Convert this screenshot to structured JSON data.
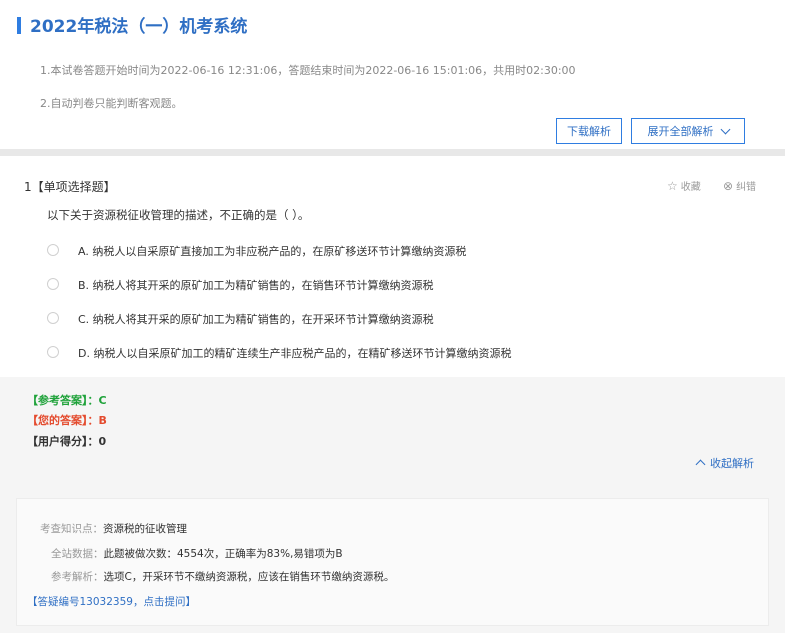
{
  "header": {
    "title": "2022年税法（一）机考系统",
    "info_line1": "1.本试卷答题开始时间为2022-06-16 12:31:06，答题结束时间为2022-06-16 15:01:06，共用时02:30:00",
    "info_line2": "2.自动判卷只能判断客观题。",
    "download_label": "下载解析",
    "expand_all_label": "展开全部解析"
  },
  "question": {
    "number_type": "1【单项选择题】",
    "favorite_label": "收藏",
    "report_error_label": "纠错",
    "stem": "以下关于资源税征收管理的描述，不正确的是（  ）。",
    "options": [
      "A. 纳税人以自采原矿直接加工为非应税产品的，在原矿移送环节计算缴纳资源税",
      "B. 纳税人将其开采的原矿加工为精矿销售的，在销售环节计算缴纳资源税",
      "C. 纳税人将其开采的原矿加工为精矿销售的，在开采环节计算缴纳资源税",
      "D. 纳税人以自采原矿加工的精矿连续生产非应税产品的，在精矿移送环节计算缴纳资源税"
    ]
  },
  "answers": {
    "reference": "【参考答案】：C",
    "yours": "【您的答案】：B",
    "score": "【用户得分】：0",
    "collapse_label": "收起解析"
  },
  "analysis": {
    "knowledge_label": "考查知识点：",
    "knowledge_value": "资源税的征收管理",
    "stats_label": "全站数据：",
    "stats_value": "此题被做次数：4554次，正确率为83%,易错项为B",
    "explain_label": "参考解析：",
    "explain_value": "选项C，开采环节不缴纳资源税，应该在销售环节缴纳资源税。",
    "question_link": "【答疑编号13032359，点击提问】"
  },
  "colors": {
    "accent": "#2f7de1",
    "correct": "#1fa23a",
    "wrong": "#e44b2e"
  }
}
